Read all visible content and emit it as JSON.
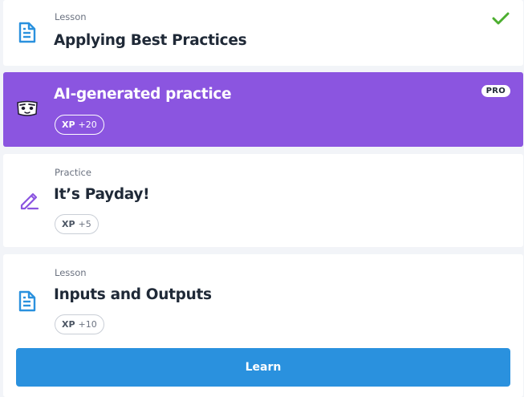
{
  "colors": {
    "page_background": "#f2f4f8",
    "card_background": "#ffffff",
    "pro_card_background": "#8b55e0",
    "lesson_icon_color": "#2a91de",
    "practice_icon_color": "#8b55e0",
    "check_color": "#4cae2f",
    "learn_button_color": "#2a91de"
  },
  "items": [
    {
      "kind": "Lesson",
      "title": "Applying Best Practices",
      "icon": "lesson-document-icon",
      "completed": true,
      "status_icon": "checkmark-icon"
    },
    {
      "title": "AI-generated practice",
      "icon": "ai-face-icon",
      "badge": "PRO",
      "xp_label": "XP",
      "xp_value": "+20"
    },
    {
      "kind": "Practice",
      "title": "It’s Payday!",
      "icon": "pencil-practice-icon",
      "xp_label": "XP",
      "xp_value": "+5"
    },
    {
      "kind": "Lesson",
      "title": "Inputs and Outputs",
      "icon": "lesson-document-icon",
      "xp_label": "XP",
      "xp_value": "+10",
      "button_label": "Learn"
    }
  ]
}
